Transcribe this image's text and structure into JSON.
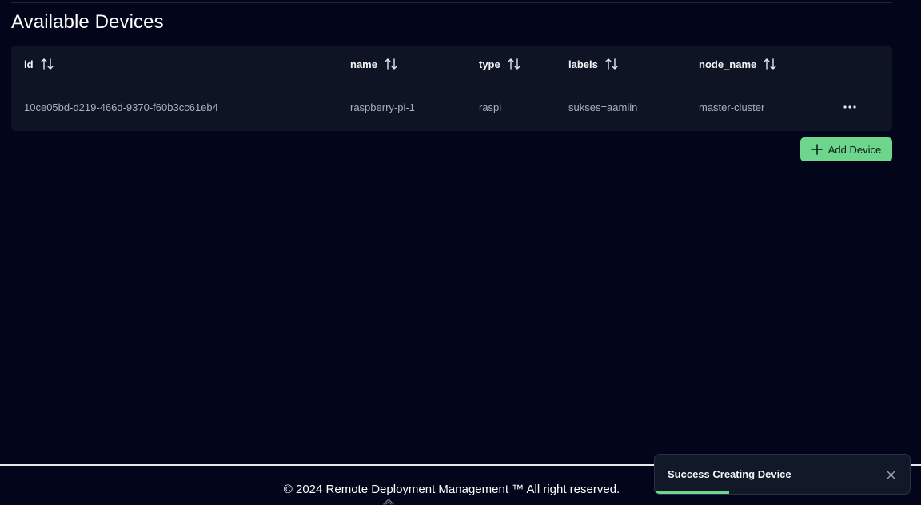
{
  "page": {
    "title": "Available Devices"
  },
  "table": {
    "columns": [
      {
        "key": "id",
        "label": "id"
      },
      {
        "key": "name",
        "label": "name"
      },
      {
        "key": "type",
        "label": "type"
      },
      {
        "key": "labels",
        "label": "labels"
      },
      {
        "key": "node_name",
        "label": "node_name"
      }
    ],
    "rows": [
      {
        "id": "10ce05bd-d219-466d-9370-f60b3cc61eb4",
        "name": "raspberry-pi-1",
        "type": "raspi",
        "labels": "sukses=aamiin",
        "node_name": "master-cluster"
      }
    ]
  },
  "actions": {
    "add_device_label": "Add Device"
  },
  "footer": {
    "text": "© 2024 Remote Deployment Management ™ All right reserved."
  },
  "toast": {
    "message": "Success Creating Device",
    "progress": 0.29
  },
  "colors": {
    "background": "#03061a",
    "card": "#0f1424",
    "accent_green": "#6dd58c"
  },
  "icons": {
    "sort": "sort-arrows-icon",
    "more": "more-horizontal-icon",
    "plus": "plus-icon",
    "close": "close-icon",
    "scroll_top": "scroll-top-icon"
  }
}
